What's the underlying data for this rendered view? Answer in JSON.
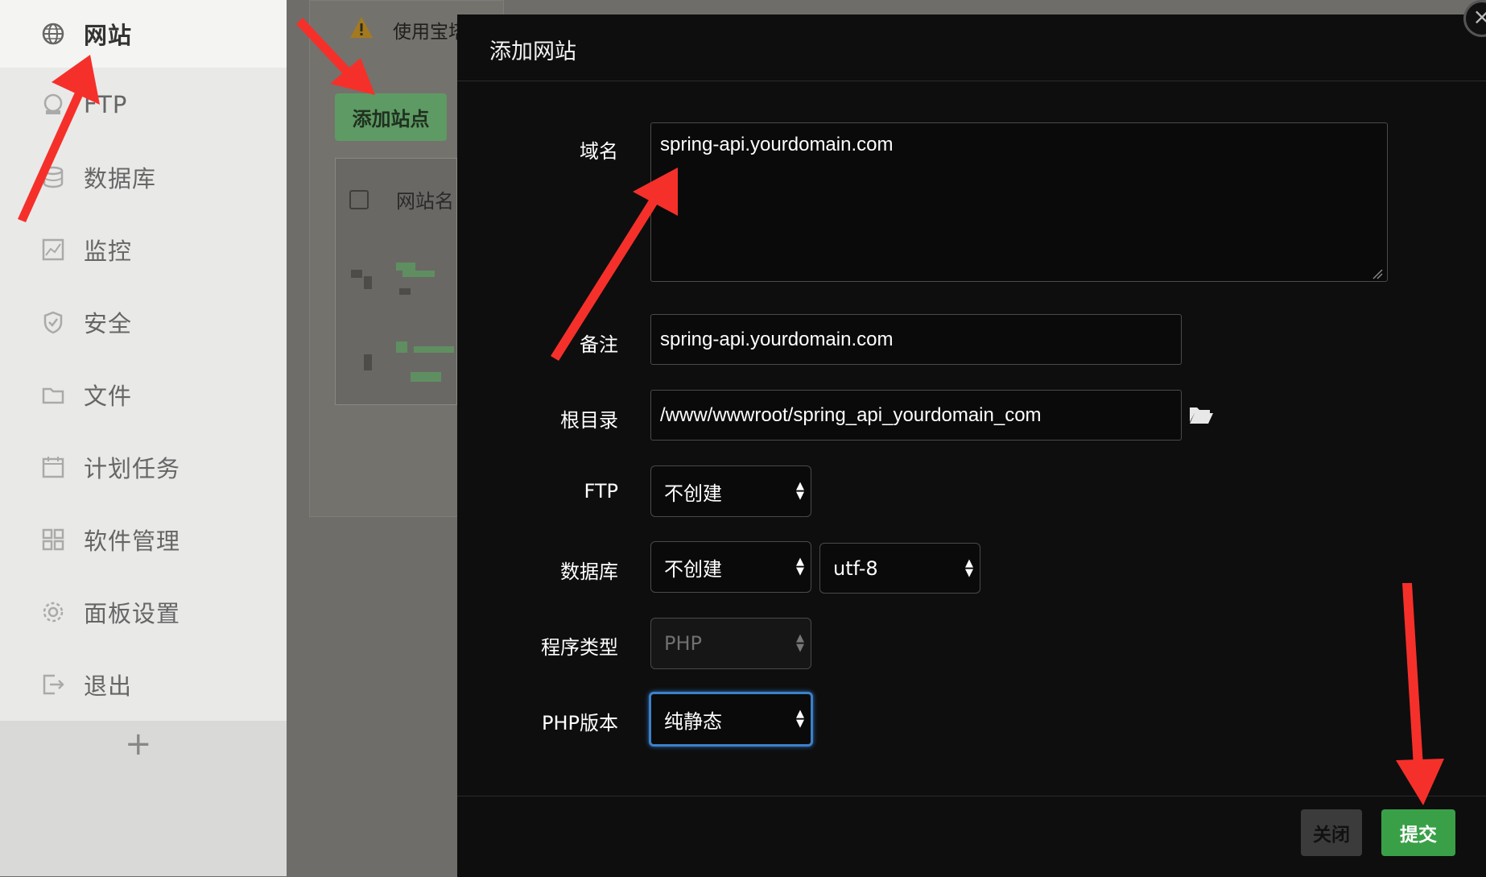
{
  "sidebar": {
    "items": [
      {
        "label": "网站",
        "icon": "globe-icon",
        "active": true
      },
      {
        "label": "FTP",
        "icon": "ftp-icon"
      },
      {
        "label": "数据库",
        "icon": "database-icon"
      },
      {
        "label": "监控",
        "icon": "monitor-icon"
      },
      {
        "label": "安全",
        "icon": "shield-icon"
      },
      {
        "label": "文件",
        "icon": "folder-icon"
      },
      {
        "label": "计划任务",
        "icon": "calendar-icon"
      },
      {
        "label": "软件管理",
        "icon": "grid-icon"
      },
      {
        "label": "面板设置",
        "icon": "gear-icon"
      },
      {
        "label": "退出",
        "icon": "logout-icon"
      }
    ],
    "add_symbol": "+"
  },
  "background": {
    "warning_text": "使用宝塔",
    "add_site_button": "添加站点",
    "table_header": "网站名"
  },
  "modal": {
    "title": "添加网站",
    "close_symbol": "×",
    "fields": {
      "domain_label": "域名",
      "domain_value": "spring-api.yourdomain.com",
      "remark_label": "备注",
      "remark_value": "spring-api.yourdomain.com",
      "root_label": "根目录",
      "root_value": "/www/wwwroot/spring_api_yourdomain_com",
      "ftp_label": "FTP",
      "ftp_value": "不创建",
      "db_label": "数据库",
      "db_value": "不创建",
      "db_charset": "utf-8",
      "program_label": "程序类型",
      "program_value": "PHP",
      "php_label": "PHP版本",
      "php_value": "纯静态"
    },
    "buttons": {
      "close": "关闭",
      "submit": "提交"
    }
  },
  "colors": {
    "annotation_arrow": "#f5302a",
    "submit_green": "#3aa048",
    "focus_blue": "#3d80c8"
  }
}
